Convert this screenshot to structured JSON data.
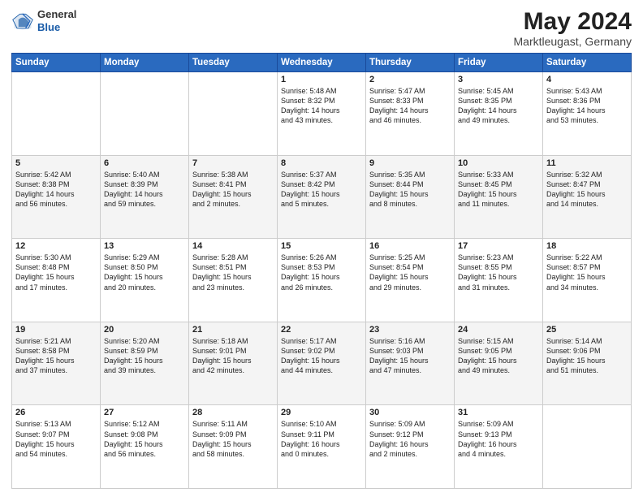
{
  "header": {
    "logo_general": "General",
    "logo_blue": "Blue",
    "month": "May 2024",
    "location": "Marktleugast, Germany"
  },
  "weekdays": [
    "Sunday",
    "Monday",
    "Tuesday",
    "Wednesday",
    "Thursday",
    "Friday",
    "Saturday"
  ],
  "weeks": [
    [
      {
        "day": "",
        "detail": ""
      },
      {
        "day": "",
        "detail": ""
      },
      {
        "day": "",
        "detail": ""
      },
      {
        "day": "1",
        "detail": "Sunrise: 5:48 AM\nSunset: 8:32 PM\nDaylight: 14 hours\nand 43 minutes."
      },
      {
        "day": "2",
        "detail": "Sunrise: 5:47 AM\nSunset: 8:33 PM\nDaylight: 14 hours\nand 46 minutes."
      },
      {
        "day": "3",
        "detail": "Sunrise: 5:45 AM\nSunset: 8:35 PM\nDaylight: 14 hours\nand 49 minutes."
      },
      {
        "day": "4",
        "detail": "Sunrise: 5:43 AM\nSunset: 8:36 PM\nDaylight: 14 hours\nand 53 minutes."
      }
    ],
    [
      {
        "day": "5",
        "detail": "Sunrise: 5:42 AM\nSunset: 8:38 PM\nDaylight: 14 hours\nand 56 minutes."
      },
      {
        "day": "6",
        "detail": "Sunrise: 5:40 AM\nSunset: 8:39 PM\nDaylight: 14 hours\nand 59 minutes."
      },
      {
        "day": "7",
        "detail": "Sunrise: 5:38 AM\nSunset: 8:41 PM\nDaylight: 15 hours\nand 2 minutes."
      },
      {
        "day": "8",
        "detail": "Sunrise: 5:37 AM\nSunset: 8:42 PM\nDaylight: 15 hours\nand 5 minutes."
      },
      {
        "day": "9",
        "detail": "Sunrise: 5:35 AM\nSunset: 8:44 PM\nDaylight: 15 hours\nand 8 minutes."
      },
      {
        "day": "10",
        "detail": "Sunrise: 5:33 AM\nSunset: 8:45 PM\nDaylight: 15 hours\nand 11 minutes."
      },
      {
        "day": "11",
        "detail": "Sunrise: 5:32 AM\nSunset: 8:47 PM\nDaylight: 15 hours\nand 14 minutes."
      }
    ],
    [
      {
        "day": "12",
        "detail": "Sunrise: 5:30 AM\nSunset: 8:48 PM\nDaylight: 15 hours\nand 17 minutes."
      },
      {
        "day": "13",
        "detail": "Sunrise: 5:29 AM\nSunset: 8:50 PM\nDaylight: 15 hours\nand 20 minutes."
      },
      {
        "day": "14",
        "detail": "Sunrise: 5:28 AM\nSunset: 8:51 PM\nDaylight: 15 hours\nand 23 minutes."
      },
      {
        "day": "15",
        "detail": "Sunrise: 5:26 AM\nSunset: 8:53 PM\nDaylight: 15 hours\nand 26 minutes."
      },
      {
        "day": "16",
        "detail": "Sunrise: 5:25 AM\nSunset: 8:54 PM\nDaylight: 15 hours\nand 29 minutes."
      },
      {
        "day": "17",
        "detail": "Sunrise: 5:23 AM\nSunset: 8:55 PM\nDaylight: 15 hours\nand 31 minutes."
      },
      {
        "day": "18",
        "detail": "Sunrise: 5:22 AM\nSunset: 8:57 PM\nDaylight: 15 hours\nand 34 minutes."
      }
    ],
    [
      {
        "day": "19",
        "detail": "Sunrise: 5:21 AM\nSunset: 8:58 PM\nDaylight: 15 hours\nand 37 minutes."
      },
      {
        "day": "20",
        "detail": "Sunrise: 5:20 AM\nSunset: 8:59 PM\nDaylight: 15 hours\nand 39 minutes."
      },
      {
        "day": "21",
        "detail": "Sunrise: 5:18 AM\nSunset: 9:01 PM\nDaylight: 15 hours\nand 42 minutes."
      },
      {
        "day": "22",
        "detail": "Sunrise: 5:17 AM\nSunset: 9:02 PM\nDaylight: 15 hours\nand 44 minutes."
      },
      {
        "day": "23",
        "detail": "Sunrise: 5:16 AM\nSunset: 9:03 PM\nDaylight: 15 hours\nand 47 minutes."
      },
      {
        "day": "24",
        "detail": "Sunrise: 5:15 AM\nSunset: 9:05 PM\nDaylight: 15 hours\nand 49 minutes."
      },
      {
        "day": "25",
        "detail": "Sunrise: 5:14 AM\nSunset: 9:06 PM\nDaylight: 15 hours\nand 51 minutes."
      }
    ],
    [
      {
        "day": "26",
        "detail": "Sunrise: 5:13 AM\nSunset: 9:07 PM\nDaylight: 15 hours\nand 54 minutes."
      },
      {
        "day": "27",
        "detail": "Sunrise: 5:12 AM\nSunset: 9:08 PM\nDaylight: 15 hours\nand 56 minutes."
      },
      {
        "day": "28",
        "detail": "Sunrise: 5:11 AM\nSunset: 9:09 PM\nDaylight: 15 hours\nand 58 minutes."
      },
      {
        "day": "29",
        "detail": "Sunrise: 5:10 AM\nSunset: 9:11 PM\nDaylight: 16 hours\nand 0 minutes."
      },
      {
        "day": "30",
        "detail": "Sunrise: 5:09 AM\nSunset: 9:12 PM\nDaylight: 16 hours\nand 2 minutes."
      },
      {
        "day": "31",
        "detail": "Sunrise: 5:09 AM\nSunset: 9:13 PM\nDaylight: 16 hours\nand 4 minutes."
      },
      {
        "day": "",
        "detail": ""
      }
    ]
  ]
}
